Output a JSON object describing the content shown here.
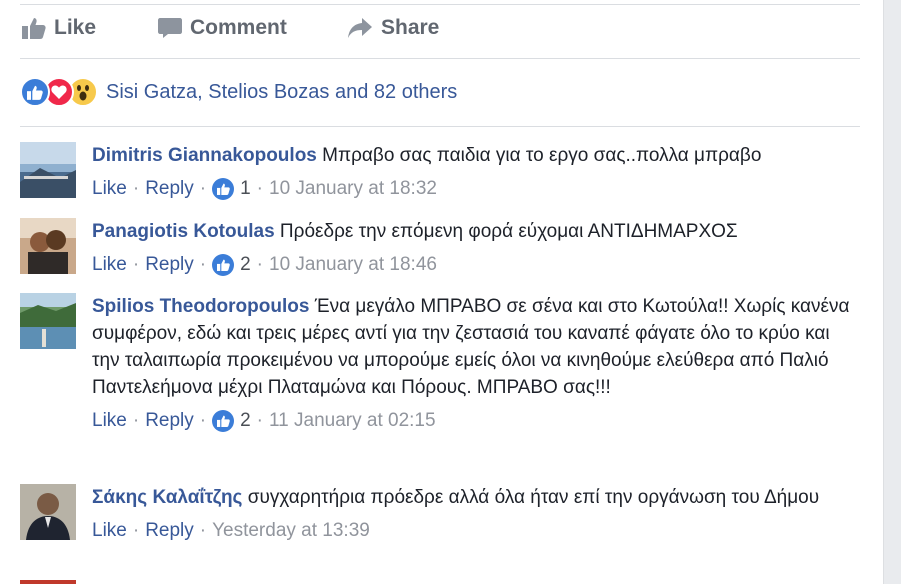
{
  "actions": {
    "like_label": "Like",
    "comment_label": "Comment",
    "share_label": "Share"
  },
  "reactions": {
    "icons": [
      "like-reaction-icon",
      "love-reaction-icon",
      "wow-reaction-icon"
    ],
    "summary": "Sisi Gatza, Stelios Bozas and 82 others"
  },
  "comments": [
    {
      "author": "Dimitris Giannakopoulos",
      "text": "Μπραβο σας παιδια για το εργο σας..πολλα μπραβο",
      "like_label": "Like",
      "reply_label": "Reply",
      "like_count": "1",
      "timestamp": "10 January at 18:32"
    },
    {
      "author": "Panagiotis Kotoulas",
      "text": "Πρόεδρε την επόμενη φορά εύχομαι ΑΝΤΙΔΗΜΑΡΧΟΣ",
      "like_label": "Like",
      "reply_label": "Reply",
      "like_count": "2",
      "timestamp": "10 January at 18:46"
    },
    {
      "author": "Spilios Theodoropoulos",
      "text": "Ένα μεγάλο ΜΠΡΑΒΟ σε σένα και στο Κωτούλα!! Χωρίς κανένα συμφέρον, εδώ και τρεις μέρες αντί για την ζεστασιά του καναπέ φάγατε όλο το κρύο και την ταλαιπωρία προκειμένου να μπορούμε εμείς όλοι να κινηθούμε ελεύθερα από Παλιό Παντελεήμονα μέχρι Πλαταμώνα και Πόρους. ΜΠΡΑΒΟ σας!!!",
      "like_label": "Like",
      "reply_label": "Reply",
      "like_count": "2",
      "timestamp": "11 January at 02:15"
    },
    {
      "author": "Σάκης Καλαΐτζης",
      "text": "συγχαρητήρια πρόεδρε αλλά όλα ήταν επί την οργάνωση του Δήμου",
      "like_label": "Like",
      "reply_label": "Reply",
      "timestamp": "Yesterday at 13:39"
    }
  ],
  "colors": {
    "link": "#385898",
    "meta": "#90949c",
    "action": "#616770",
    "like_blue": "#3b7dd8",
    "love_red": "#f0284a",
    "wow_yellow": "#f7c94b"
  }
}
